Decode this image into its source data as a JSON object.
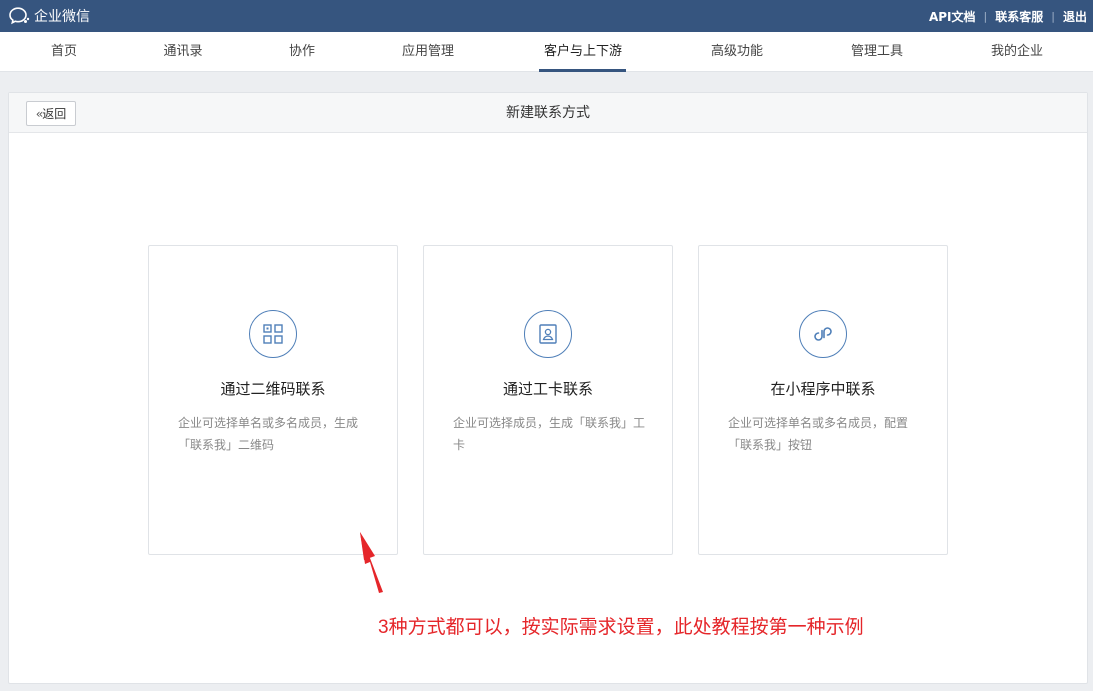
{
  "topbar": {
    "brand": "企业微信",
    "links": [
      "API文档",
      "联系客服",
      "退出"
    ]
  },
  "nav": {
    "items": [
      "首页",
      "通讯录",
      "协作",
      "应用管理",
      "客户与上下游",
      "高级功能",
      "管理工具",
      "我的企业"
    ],
    "active_index": 4
  },
  "panel": {
    "back_label": "返回",
    "title": "新建联系方式"
  },
  "cards": [
    {
      "title": "通过二维码联系",
      "desc": "企业可选择单名或多名成员，生成「联系我」二维码",
      "icon": "qr-code-icon"
    },
    {
      "title": "通过工卡联系",
      "desc": "企业可选择成员，生成「联系我」工卡",
      "icon": "badge-icon"
    },
    {
      "title": "在小程序中联系",
      "desc": "企业可选择单名或多名成员，配置「联系我」按钮",
      "icon": "mini-program-icon"
    }
  ],
  "annotation": {
    "text": "3种方式都可以，按实际需求设置，此处教程按第一种示例",
    "color": "#e5262a"
  },
  "colors": {
    "topbar": "#36557f",
    "accent": "#4f7fb8"
  }
}
